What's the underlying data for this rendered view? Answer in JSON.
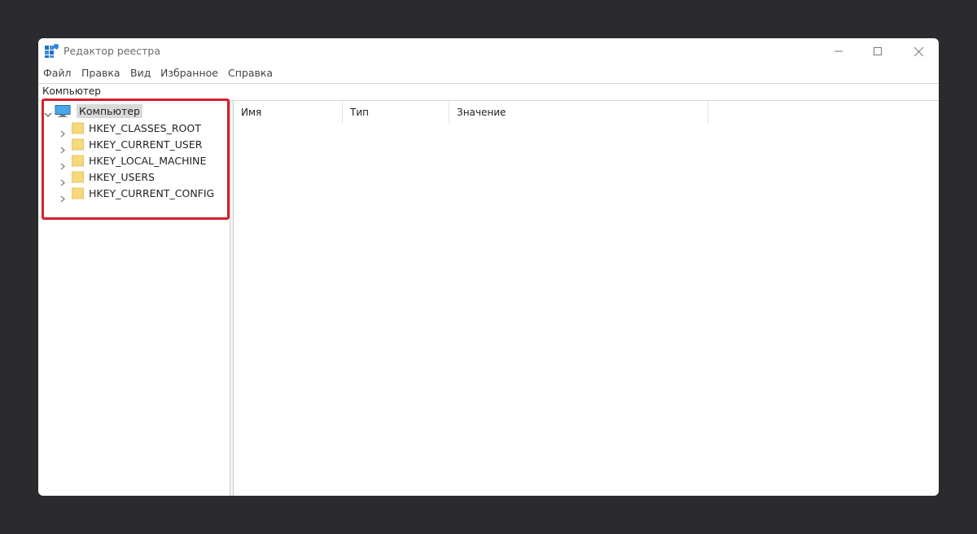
{
  "window": {
    "title": "Редактор реестра"
  },
  "menu": [
    "Файл",
    "Правка",
    "Вид",
    "Избранное",
    "Справка"
  ],
  "address": "Компьютер",
  "tree": {
    "root": "Компьютер",
    "children": [
      "HKEY_CLASSES_ROOT",
      "HKEY_CURRENT_USER",
      "HKEY_LOCAL_MACHINE",
      "HKEY_USERS",
      "HKEY_CURRENT_CONFIG"
    ]
  },
  "columns": [
    "Имя",
    "Тип",
    "Значение"
  ],
  "icons": {
    "app": "registry-editor-icon",
    "root": "computer-icon",
    "node": "folder-icon",
    "expand": "chevron-right-icon",
    "collapse": "chevron-down-icon"
  },
  "colors": {
    "backdrop": "#2b2a2f",
    "highlight": "#d5202a",
    "folder": "#f7d87c",
    "selection": "#d9d9d9"
  }
}
